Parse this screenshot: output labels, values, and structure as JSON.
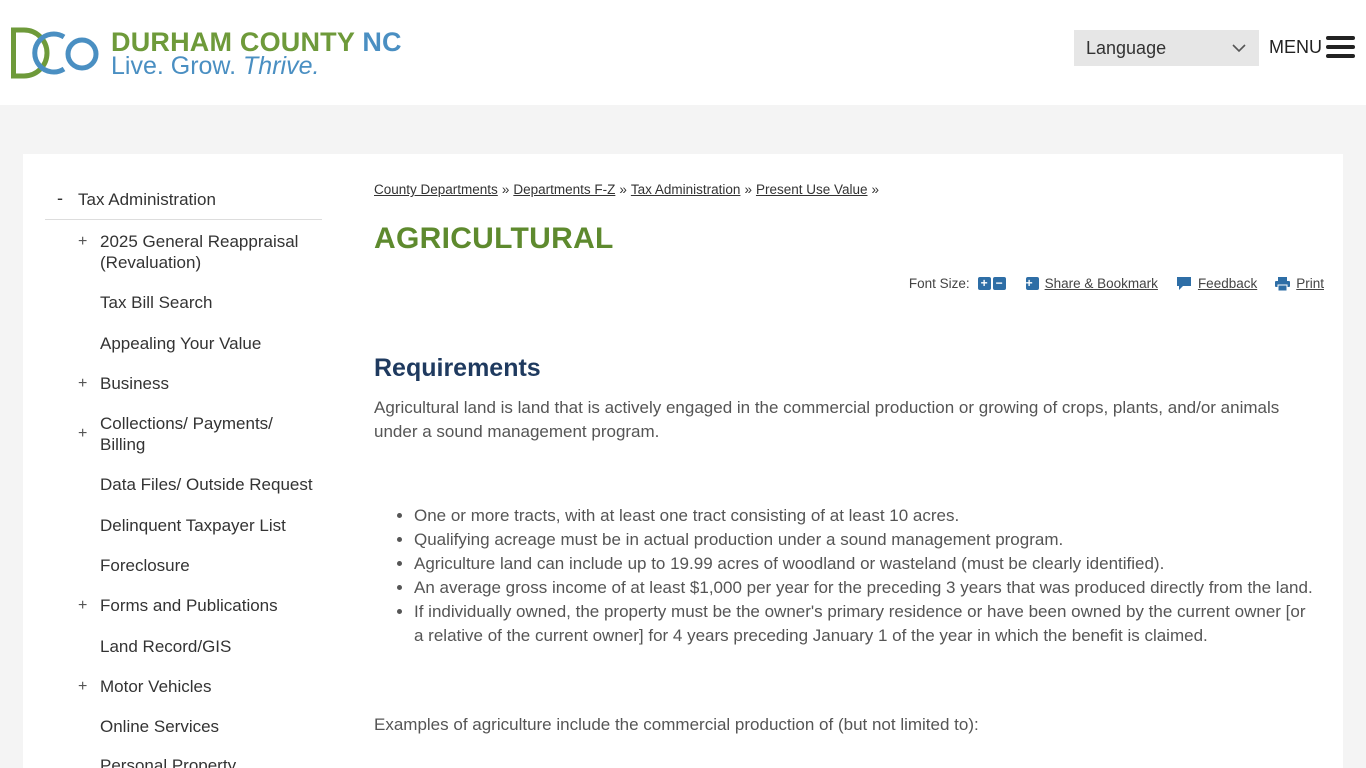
{
  "header": {
    "logo_name": "DURHAM COUNTY",
    "logo_name_suffix": "NC",
    "logo_tag_plain": "Live. Grow.",
    "logo_tag_italic": "Thrive.",
    "language_label": "Language",
    "menu_label": "MENU"
  },
  "colors": {
    "green": "#6e9a3a",
    "blue": "#4a8fc2",
    "title_green": "#5e8a2e",
    "navy": "#1f3a5f"
  },
  "sidebar": {
    "top_label": "Tax Administration",
    "top_toggle": "-",
    "items": [
      {
        "label": "2025 General Reappraisal (Revaluation)",
        "toggle": "+"
      },
      {
        "label": "Tax Bill Search",
        "toggle": ""
      },
      {
        "label": "Appealing Your Value",
        "toggle": ""
      },
      {
        "label": "Business",
        "toggle": "+"
      },
      {
        "label": "Collections/ Payments/ Billing",
        "toggle": "+"
      },
      {
        "label": "Data Files/ Outside Request",
        "toggle": ""
      },
      {
        "label": "Delinquent Taxpayer List",
        "toggle": ""
      },
      {
        "label": "Foreclosure",
        "toggle": ""
      },
      {
        "label": "Forms and Publications",
        "toggle": "+"
      },
      {
        "label": "Land Record/GIS",
        "toggle": ""
      },
      {
        "label": "Motor Vehicles",
        "toggle": "+"
      },
      {
        "label": "Online Services",
        "toggle": ""
      },
      {
        "label": "Personal Property",
        "toggle": ""
      }
    ]
  },
  "breadcrumb": {
    "items": [
      "County Departments",
      "Departments F-Z",
      "Tax Administration",
      "Present Use Value"
    ],
    "separator": "»"
  },
  "page_title": "AGRICULTURAL",
  "tools": {
    "font_size_label": "Font Size:",
    "increase": "+",
    "decrease": "−",
    "share_label": "Share & Bookmark",
    "feedback_label": "Feedback",
    "print_label": "Print"
  },
  "content": {
    "heading": "Requirements",
    "intro": "Agricultural land is land that is actively engaged in the commercial production or growing of crops, plants, and/or animals under a sound management program.",
    "bullets": [
      "One or more tracts, with at least one tract consisting of at least 10 acres.",
      "Qualifying acreage must be in actual production under a sound management program.",
      "Agriculture land can include up to 19.99 acres of woodland or wasteland (must be clearly identified).",
      "An average gross income of at least $1,000 per year for the preceding 3 years that was produced directly from the land.",
      "If individually owned, the property must be the owner's primary residence or have been owned by the current owner [or a relative of the current owner] for 4 years preceding January 1 of the year in which the benefit is claimed."
    ],
    "examples": "Examples of agriculture include the commercial production of (but not limited to):"
  }
}
